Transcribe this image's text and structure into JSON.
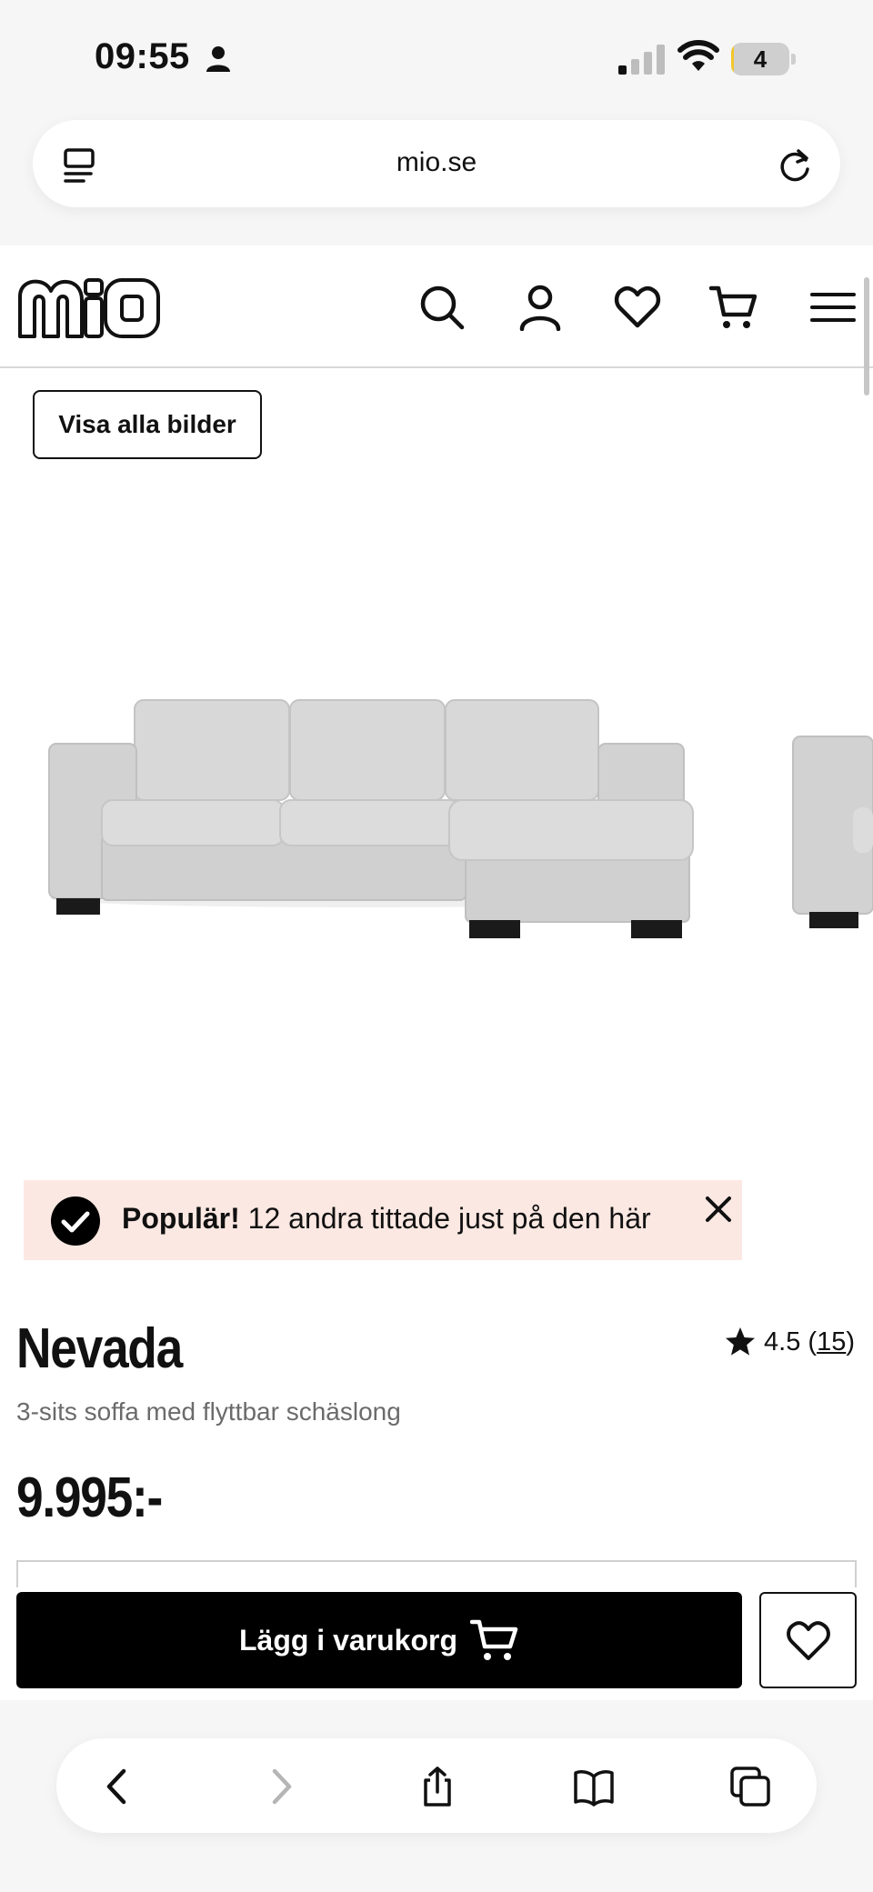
{
  "status_bar": {
    "time": "09:55",
    "battery_level": 4,
    "battery_label": "4",
    "signal_bars_active": 1,
    "signal_bars_total": 4
  },
  "browser": {
    "url": "mio.se",
    "icons": [
      "tabs-icon",
      "reload-icon"
    ]
  },
  "site_header": {
    "logo_text": "mio",
    "icons": [
      "search-icon",
      "account-icon",
      "heart-icon",
      "cart-icon",
      "menu-icon"
    ]
  },
  "gallery": {
    "show_all_label": "Visa alla bilder"
  },
  "popular_banner": {
    "bold": "Populär!",
    "text": " 12 andra tittade just på den här"
  },
  "product": {
    "name": "Nevada",
    "subtitle": "3-sits soffa med flyttbar schäslong",
    "price": "9.995:-",
    "rating": "4.5",
    "review_count": "15"
  },
  "actions": {
    "add_to_cart_label": "Lägg i varukorg"
  },
  "bottom_toolbar": {
    "icons": [
      "back-icon",
      "forward-icon",
      "share-icon",
      "bookmarks-icon",
      "tabs-overview-icon"
    ]
  },
  "colors": {
    "banner_bg": "#fbe8e2",
    "sofa_fabric": "#d6d6d6",
    "primary_button": "#000000",
    "battery_accent": "#f3c62a"
  }
}
